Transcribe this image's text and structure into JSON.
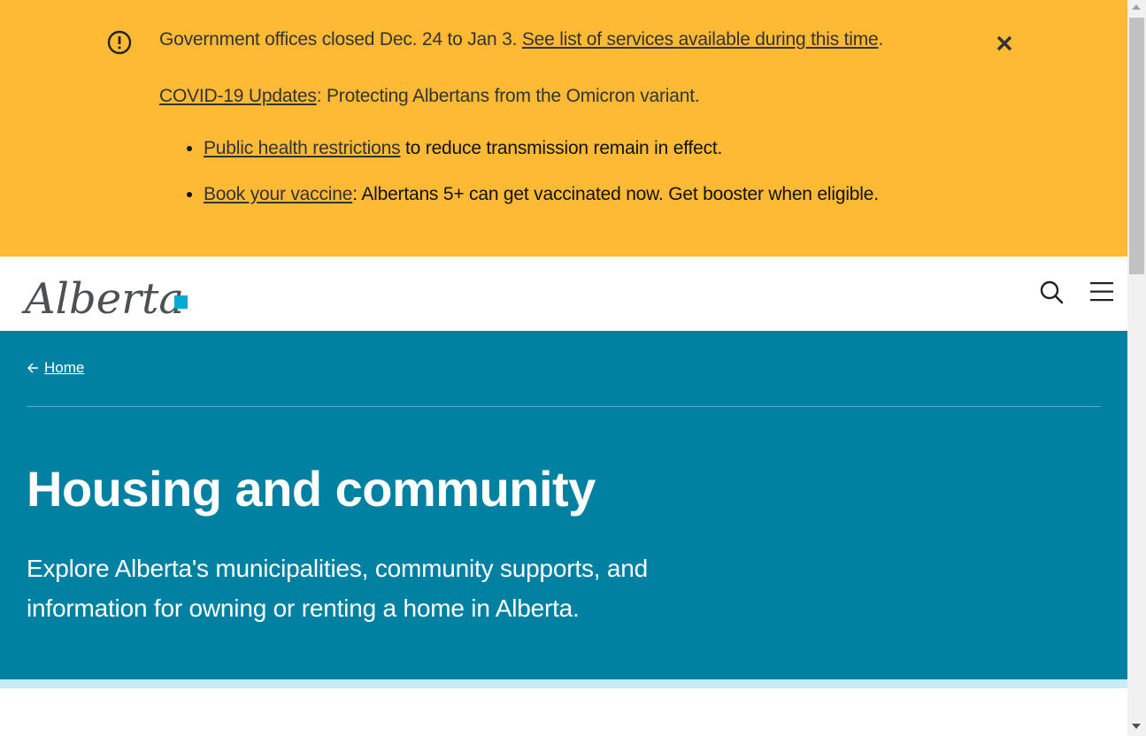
{
  "alert": {
    "icon": "exclamation-circle-icon",
    "close_icon": "close-icon",
    "line1_text": "Government offices closed Dec. 24 to Jan 3. ",
    "line1_link": "See list of services available during this time",
    "line1_end": ".",
    "line2_link": "COVID-19 Updates",
    "line2_text": ": Protecting Albertans from the Omicron variant.",
    "bullets": [
      {
        "link": "Public health restrictions",
        "text": " to reduce transmission remain in effect."
      },
      {
        "link": "Book your vaccine",
        "text": ": Albertans 5+ can get vaccinated now. Get booster when eligible."
      }
    ],
    "color": "#ffba35"
  },
  "header": {
    "logo_text": "Alberta",
    "logo_accent_color": "#00aad2",
    "search_icon": "search-icon",
    "menu_icon": "hamburger-menu-icon"
  },
  "hero": {
    "breadcrumb_icon": "arrow-left-icon",
    "breadcrumb_label": "Home",
    "title": "Housing and community",
    "description": "Explore Alberta's municipalities, community supports, and information for owning or renting a home in Alberta.",
    "background_color": "#0081a2"
  }
}
